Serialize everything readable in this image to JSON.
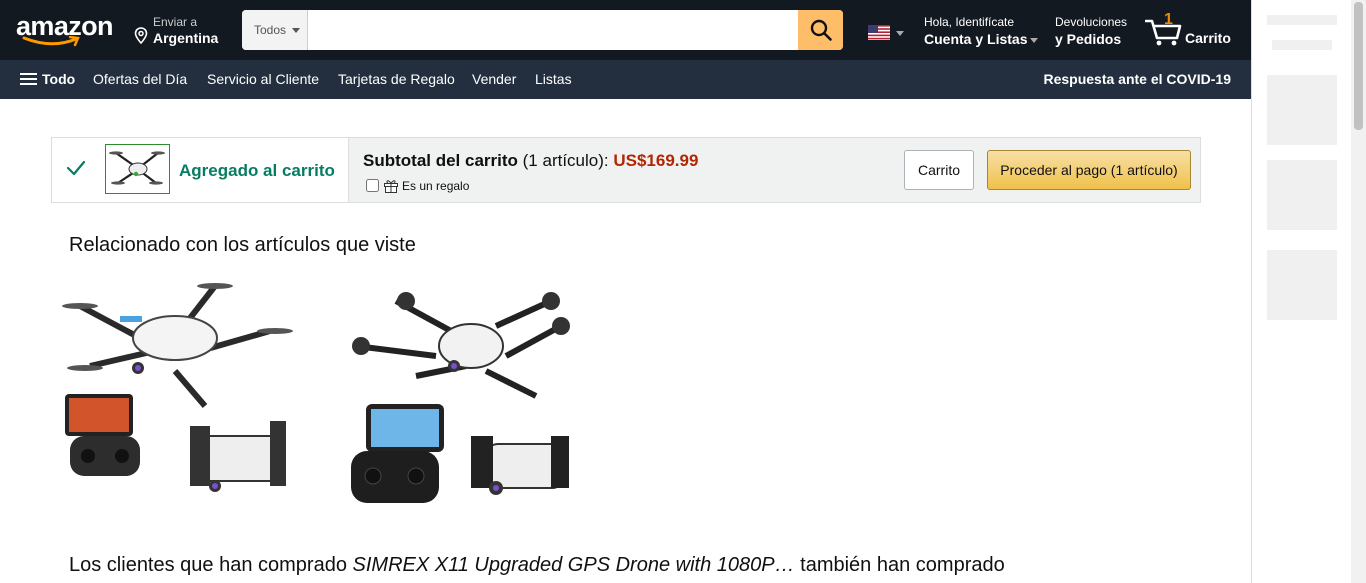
{
  "header": {
    "logo_text": "amazon",
    "deliver": {
      "line1": "Enviar a",
      "line2": "Argentina"
    },
    "search": {
      "category": "Todos",
      "placeholder": "",
      "value": ""
    },
    "account": {
      "line1": "Hola, Identifícate",
      "line2": "Cuenta y Listas"
    },
    "orders": {
      "line1": "Devoluciones",
      "line2": "y Pedidos"
    },
    "cart": {
      "count": "1",
      "label": "Carrito"
    }
  },
  "subnav": {
    "all_label": "Todo",
    "links": [
      "Ofertas del Día",
      "Servicio al Cliente",
      "Tarjetas de Regalo",
      "Vender",
      "Listas"
    ],
    "covid": "Respuesta ante el COVID-19"
  },
  "added": {
    "status": "Agregado al carrito",
    "subtotal_label": "Subtotal del carrito",
    "subtotal_count": " (1 artículo): ",
    "subtotal_price": "US$169.99",
    "gift_label": "Es un regalo",
    "cart_button": "Carrito",
    "checkout_button": "Proceder al pago (1 artículo)"
  },
  "related": {
    "title": "Relacionado con los artículos que viste"
  },
  "also_bought": {
    "prefix": "Los clientes que han comprado ",
    "product": "SIMREX X11 Upgraded GPS Drone with 1080P…",
    "suffix": " también han comprado"
  },
  "colors": {
    "nav_dark": "#131921",
    "nav_sub": "#232f3e",
    "accent": "#febd69",
    "price": "#b12704",
    "added_green": "#067d62"
  }
}
